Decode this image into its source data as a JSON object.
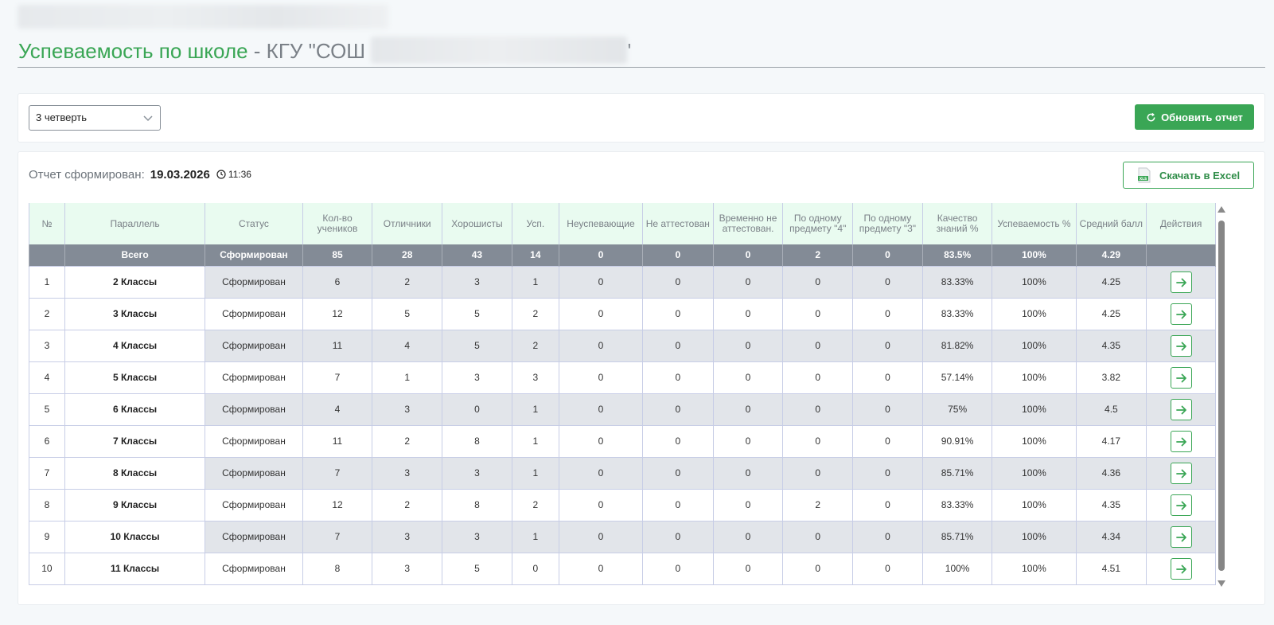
{
  "page": {
    "title_green": "Успеваемость по школе",
    "title_rest": " - КГУ \"СОШ",
    "title_tail": "'"
  },
  "filter": {
    "period_value": "3 четверть",
    "refresh_label": "Обновить отчет"
  },
  "report": {
    "generated_label": "Отчет сформирован:",
    "generated_date": "19.03.2026",
    "generated_time": "11:36",
    "excel_label": "Скачать в Excel"
  },
  "colors": {
    "accent": "#3aa655",
    "total_row": "#838b96",
    "header_bg": "#e9fbf0"
  },
  "table": {
    "headers": [
      "№",
      "Параллель",
      "Статус",
      "Кол-во учеников",
      "Отличники",
      "Хорошисты",
      "Усп.",
      "Неуспевающие",
      "Не аттестован",
      "Временно не аттестован.",
      "По одному предмету \"4\"",
      "По одному предмету \"3\"",
      "Качество знаний %",
      "Успеваемость %",
      "Средний балл",
      "Действия"
    ],
    "total": [
      "",
      "Всего",
      "Сформирован",
      "85",
      "28",
      "43",
      "14",
      "0",
      "0",
      "0",
      "2",
      "0",
      "83.5%",
      "100%",
      "4.29"
    ],
    "rows": [
      [
        "1",
        "2 Классы",
        "Сформирован",
        "6",
        "2",
        "3",
        "1",
        "0",
        "0",
        "0",
        "0",
        "0",
        "83.33%",
        "100%",
        "4.25"
      ],
      [
        "2",
        "3 Классы",
        "Сформирован",
        "12",
        "5",
        "5",
        "2",
        "0",
        "0",
        "0",
        "0",
        "0",
        "83.33%",
        "100%",
        "4.25"
      ],
      [
        "3",
        "4 Классы",
        "Сформирован",
        "11",
        "4",
        "5",
        "2",
        "0",
        "0",
        "0",
        "0",
        "0",
        "81.82%",
        "100%",
        "4.35"
      ],
      [
        "4",
        "5 Классы",
        "Сформирован",
        "7",
        "1",
        "3",
        "3",
        "0",
        "0",
        "0",
        "0",
        "0",
        "57.14%",
        "100%",
        "3.82"
      ],
      [
        "5",
        "6 Классы",
        "Сформирован",
        "4",
        "3",
        "0",
        "1",
        "0",
        "0",
        "0",
        "0",
        "0",
        "75%",
        "100%",
        "4.5"
      ],
      [
        "6",
        "7 Классы",
        "Сформирован",
        "11",
        "2",
        "8",
        "1",
        "0",
        "0",
        "0",
        "0",
        "0",
        "90.91%",
        "100%",
        "4.17"
      ],
      [
        "7",
        "8 Классы",
        "Сформирован",
        "7",
        "3",
        "3",
        "1",
        "0",
        "0",
        "0",
        "0",
        "0",
        "85.71%",
        "100%",
        "4.36"
      ],
      [
        "8",
        "9 Классы",
        "Сформирован",
        "12",
        "2",
        "8",
        "2",
        "0",
        "0",
        "0",
        "2",
        "0",
        "83.33%",
        "100%",
        "4.35"
      ],
      [
        "9",
        "10 Классы",
        "Сформирован",
        "7",
        "3",
        "3",
        "1",
        "0",
        "0",
        "0",
        "0",
        "0",
        "85.71%",
        "100%",
        "4.34"
      ],
      [
        "10",
        "11 Классы",
        "Сформирован",
        "8",
        "3",
        "5",
        "0",
        "0",
        "0",
        "0",
        "0",
        "0",
        "100%",
        "100%",
        "4.51"
      ]
    ],
    "action_icon": "arrow-right-icon"
  }
}
